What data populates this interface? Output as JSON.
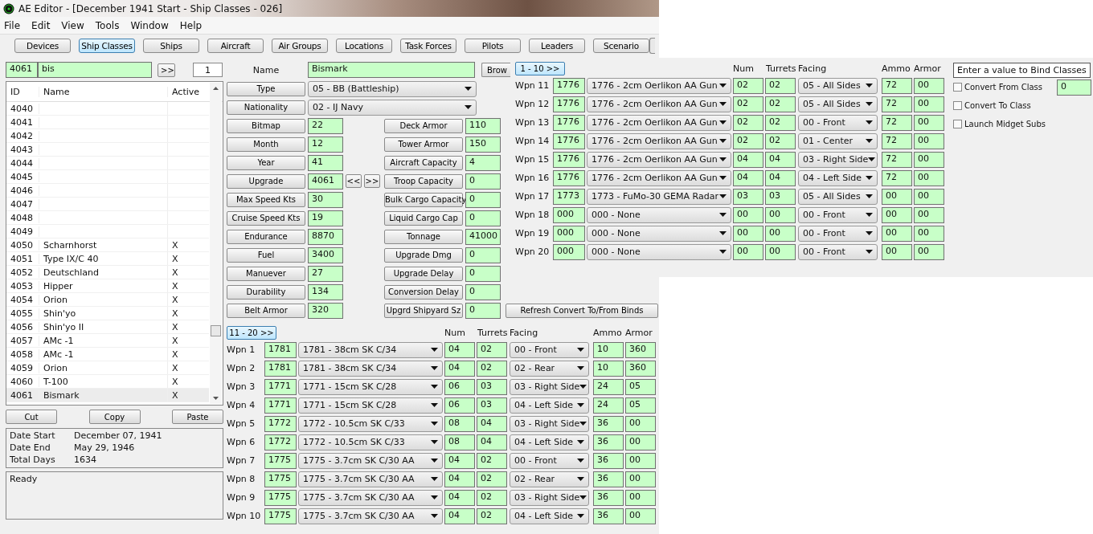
{
  "window": {
    "title": "AE Editor - [December 1941 Start - Ship Classes - 026]"
  },
  "menu": [
    "File",
    "Edit",
    "View",
    "Tools",
    "Window",
    "Help"
  ],
  "toolbar": [
    {
      "label": "Devices",
      "selected": false
    },
    {
      "label": "Ship Classes",
      "selected": true
    },
    {
      "label": "Ships",
      "selected": false
    },
    {
      "label": "Aircraft",
      "selected": false
    },
    {
      "label": "Air Groups",
      "selected": false
    },
    {
      "label": "Locations",
      "selected": false
    },
    {
      "label": "Task Forces",
      "selected": false
    },
    {
      "label": "Pilots",
      "selected": false
    },
    {
      "label": "Leaders",
      "selected": false
    },
    {
      "label": "Scenario",
      "selected": false
    }
  ],
  "search": {
    "id": "4061",
    "text": "bis",
    "go": ">>",
    "count": "1"
  },
  "class_list": {
    "columns": [
      "ID",
      "Name",
      "Active"
    ],
    "rows": [
      {
        "id": "4040",
        "selected": false
      },
      {
        "id": "4041",
        "selected": false
      },
      {
        "id": "4042",
        "selected": false
      },
      {
        "id": "4043",
        "selected": false
      },
      {
        "id": "4044",
        "selected": false
      },
      {
        "id": "4045",
        "selected": false
      },
      {
        "id": "4046",
        "selected": false
      },
      {
        "id": "4047",
        "selected": false
      },
      {
        "id": "4048",
        "selected": false
      },
      {
        "id": "4049",
        "selected": false
      },
      {
        "id": "4050",
        "name": "Scharnhorst",
        "active": "X",
        "selected": false
      },
      {
        "id": "4051",
        "name": "Type IX/C 40",
        "active": "X",
        "selected": false
      },
      {
        "id": "4052",
        "name": "Deutschland",
        "active": "X",
        "selected": false
      },
      {
        "id": "4053",
        "name": "Hipper",
        "active": "X",
        "selected": false
      },
      {
        "id": "4054",
        "name": "Orion",
        "active": "X",
        "selected": false
      },
      {
        "id": "4055",
        "name": "Shin'yo",
        "active": "X",
        "selected": false
      },
      {
        "id": "4056",
        "name": "Shin'yo II",
        "active": "X",
        "selected": false
      },
      {
        "id": "4057",
        "name": "AMc -1",
        "active": "X",
        "selected": false
      },
      {
        "id": "4058",
        "name": "AMc -1",
        "active": "X",
        "selected": false
      },
      {
        "id": "4059",
        "name": "Orion",
        "active": "X",
        "selected": false
      },
      {
        "id": "4060",
        "name": "T-100",
        "active": "X",
        "selected": false
      },
      {
        "id": "4061",
        "name": "Bismark",
        "active": "X",
        "selected": true
      }
    ]
  },
  "edit_buttons": [
    "Cut",
    "Copy",
    "Paste"
  ],
  "dates": [
    {
      "label": "Date Start",
      "value": "December 07, 1941"
    },
    {
      "label": "Date End",
      "value": "May 29, 1946"
    },
    {
      "label": "Total Days",
      "value": "1634"
    }
  ],
  "status": "Ready",
  "form": {
    "name_label": "Name",
    "name": "Bismark",
    "browse": "Brow",
    "type_label": "Type",
    "type": "05 - BB (Battleship)",
    "nationality_label": "Nationality",
    "nationality": "02 - IJ Navy",
    "left_fields": [
      {
        "label": "Bitmap",
        "value": "22"
      },
      {
        "label": "Month",
        "value": "12"
      },
      {
        "label": "Year",
        "value": "41"
      },
      {
        "label": "Upgrade",
        "value": "4061",
        "arrows": [
          "<<",
          ">>"
        ]
      },
      {
        "label": "Max Speed Kts",
        "value": "30"
      },
      {
        "label": "Cruise Speed Kts",
        "value": "19"
      },
      {
        "label": "Endurance",
        "value": "8870"
      },
      {
        "label": "Fuel",
        "value": "3400"
      },
      {
        "label": "Manuever",
        "value": "27"
      },
      {
        "label": "Durability",
        "value": "134"
      },
      {
        "label": "Belt Armor",
        "value": "320"
      }
    ],
    "right_fields": [
      {
        "label": "Deck Armor",
        "value": "110"
      },
      {
        "label": "Tower Armor",
        "value": "150"
      },
      {
        "label": "Aircraft Capacity",
        "value": "4"
      },
      {
        "label": "Troop Capacity",
        "value": "0"
      },
      {
        "label": "Bulk Cargo Capacity",
        "value": "0"
      },
      {
        "label": "Liquid Cargo Cap",
        "value": "0"
      },
      {
        "label": "Tonnage",
        "value": "41000"
      },
      {
        "label": "Upgrade Dmg",
        "value": "0"
      },
      {
        "label": "Upgrade Delay",
        "value": "0"
      },
      {
        "label": "Conversion Delay",
        "value": "0"
      },
      {
        "label": "Upgrd Shipyard Sz",
        "value": "0"
      }
    ],
    "refresh": "Refresh Convert To/From Binds"
  },
  "weapons_main": {
    "page_button": "11 - 20  >>",
    "columns": [
      "Num",
      "Turrets",
      "Facing",
      "Ammo",
      "Armor"
    ],
    "rows": [
      {
        "label": "Wpn 1",
        "id": "1781",
        "device": "1781 - 38cm SK C/34",
        "num": "04",
        "turrets": "02",
        "facing": "00 - Front",
        "ammo": "10",
        "armor": "360"
      },
      {
        "label": "Wpn 2",
        "id": "1781",
        "device": "1781 - 38cm SK C/34",
        "num": "04",
        "turrets": "02",
        "facing": "02 - Rear",
        "ammo": "10",
        "armor": "360"
      },
      {
        "label": "Wpn 3",
        "id": "1771",
        "device": "1771 - 15cm SK C/28",
        "num": "06",
        "turrets": "03",
        "facing": "03 - Right Side",
        "ammo": "24",
        "armor": "05"
      },
      {
        "label": "Wpn 4",
        "id": "1771",
        "device": "1771 - 15cm SK C/28",
        "num": "06",
        "turrets": "03",
        "facing": "04 - Left Side",
        "ammo": "24",
        "armor": "05"
      },
      {
        "label": "Wpn 5",
        "id": "1772",
        "device": "1772 - 10.5cm SK C/33",
        "num": "08",
        "turrets": "04",
        "facing": "03 - Right Side",
        "ammo": "36",
        "armor": "00"
      },
      {
        "label": "Wpn 6",
        "id": "1772",
        "device": "1772 - 10.5cm SK C/33",
        "num": "08",
        "turrets": "04",
        "facing": "04 - Left Side",
        "ammo": "36",
        "armor": "00"
      },
      {
        "label": "Wpn 7",
        "id": "1775",
        "device": "1775 - 3.7cm SK C/30 AA",
        "num": "04",
        "turrets": "02",
        "facing": "00 - Front",
        "ammo": "36",
        "armor": "00"
      },
      {
        "label": "Wpn 8",
        "id": "1775",
        "device": "1775 - 3.7cm SK C/30 AA",
        "num": "04",
        "turrets": "02",
        "facing": "02 - Rear",
        "ammo": "36",
        "armor": "00"
      },
      {
        "label": "Wpn 9",
        "id": "1775",
        "device": "1775 - 3.7cm SK C/30 AA",
        "num": "04",
        "turrets": "02",
        "facing": "03 - Right Side",
        "ammo": "36",
        "armor": "00"
      },
      {
        "label": "Wpn 10",
        "id": "1775",
        "device": "1775 - 3.7cm SK C/30 AA",
        "num": "04",
        "turrets": "02",
        "facing": "04 - Left Side",
        "ammo": "36",
        "armor": "00"
      }
    ]
  },
  "weapons_overlay": {
    "page_button": "1 - 10  >>",
    "columns": [
      "Num",
      "Turrets",
      "Facing",
      "Ammo",
      "Armor"
    ],
    "rows": [
      {
        "label": "Wpn 11",
        "id": "1776",
        "device": "1776 - 2cm Oerlikon AA Gun",
        "num": "02",
        "turrets": "02",
        "facing": "05 - All Sides",
        "ammo": "72",
        "armor": "00"
      },
      {
        "label": "Wpn 12",
        "id": "1776",
        "device": "1776 - 2cm Oerlikon AA Gun",
        "num": "02",
        "turrets": "02",
        "facing": "05 - All Sides",
        "ammo": "72",
        "armor": "00"
      },
      {
        "label": "Wpn 13",
        "id": "1776",
        "device": "1776 - 2cm Oerlikon AA Gun",
        "num": "02",
        "turrets": "02",
        "facing": "00 - Front",
        "ammo": "72",
        "armor": "00"
      },
      {
        "label": "Wpn 14",
        "id": "1776",
        "device": "1776 - 2cm Oerlikon AA Gun",
        "num": "02",
        "turrets": "02",
        "facing": "01 - Center",
        "ammo": "72",
        "armor": "00"
      },
      {
        "label": "Wpn 15",
        "id": "1776",
        "device": "1776 - 2cm Oerlikon AA Gun",
        "num": "04",
        "turrets": "04",
        "facing": "03 - Right Side",
        "ammo": "72",
        "armor": "00"
      },
      {
        "label": "Wpn 16",
        "id": "1776",
        "device": "1776 - 2cm Oerlikon AA Gun",
        "num": "04",
        "turrets": "04",
        "facing": "04 - Left Side",
        "ammo": "72",
        "armor": "00"
      },
      {
        "label": "Wpn 17",
        "id": "1773",
        "device": "1773 - FuMo-30 GEMA Radar",
        "num": "03",
        "turrets": "03",
        "facing": "05 - All Sides",
        "ammo": "00",
        "armor": "00"
      },
      {
        "label": "Wpn 18",
        "id": "000",
        "device": "000 - None",
        "num": "00",
        "turrets": "00",
        "facing": "00 - Front",
        "ammo": "00",
        "armor": "00"
      },
      {
        "label": "Wpn 19",
        "id": "000",
        "device": "000 - None",
        "num": "00",
        "turrets": "00",
        "facing": "00 - Front",
        "ammo": "00",
        "armor": "00"
      },
      {
        "label": "Wpn 20",
        "id": "000",
        "device": "000 - None",
        "num": "00",
        "turrets": "00",
        "facing": "00 - Front",
        "ammo": "00",
        "armor": "00"
      }
    ]
  },
  "bind": {
    "title": "Enter a value to Bind Classes",
    "options": [
      {
        "label": "Convert From Class",
        "checked": false,
        "value": "0"
      },
      {
        "label": "Convert To Class",
        "checked": false
      },
      {
        "label": "Launch Midget Subs",
        "checked": false
      }
    ]
  }
}
